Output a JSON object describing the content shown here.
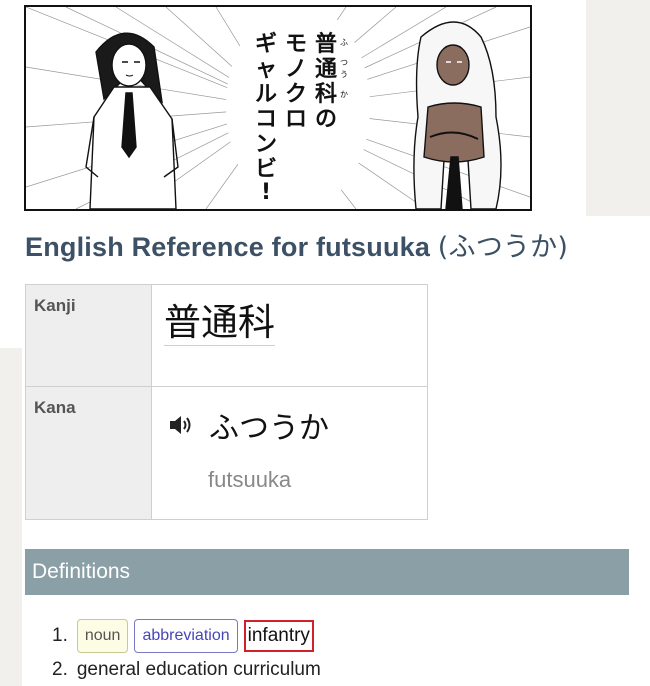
{
  "manga": {
    "caption": [
      "普通科の",
      "モノクロ",
      "ギャルコンビ!"
    ],
    "furigana": "ふつうか"
  },
  "title": {
    "text": "English Reference for futsuuka ",
    "kana": "(ふつうか)"
  },
  "reading_table": {
    "kanji_label": "Kanji",
    "kanji_value": "普通科",
    "kana_label": "Kana",
    "kana_value": "ふつうか",
    "romaji": "futsuuka"
  },
  "definitions": {
    "header": "Definitions",
    "items": [
      {
        "number": "1.",
        "tags": [
          "noun",
          "abbreviation"
        ],
        "gloss": "infantry"
      },
      {
        "number": "2.",
        "gloss": "general education curriculum"
      }
    ]
  },
  "colors": {
    "title": "#3c5165",
    "definitions_header_bg": "#8a9fa6",
    "highlight_border": "#d0202a",
    "abbreviation_tag": "#4646b8",
    "noun_tag_bg": "#fdfde5"
  },
  "icons": {
    "audio": "speaker-icon"
  }
}
